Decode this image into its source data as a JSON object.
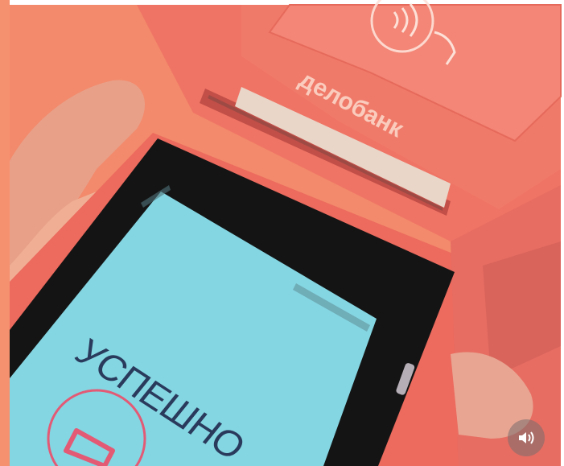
{
  "photo": {
    "screen_text": "УСПЕШНО",
    "brand_text": "делобанк",
    "icons": [
      "contactless-payment-icon",
      "volume-icon",
      "printer-icon"
    ]
  },
  "colors": {
    "background": "#f38a6b",
    "terminal_body": "#ee6f63",
    "screen": "#7fd3e1",
    "screen_text": "#2a3a5c"
  }
}
